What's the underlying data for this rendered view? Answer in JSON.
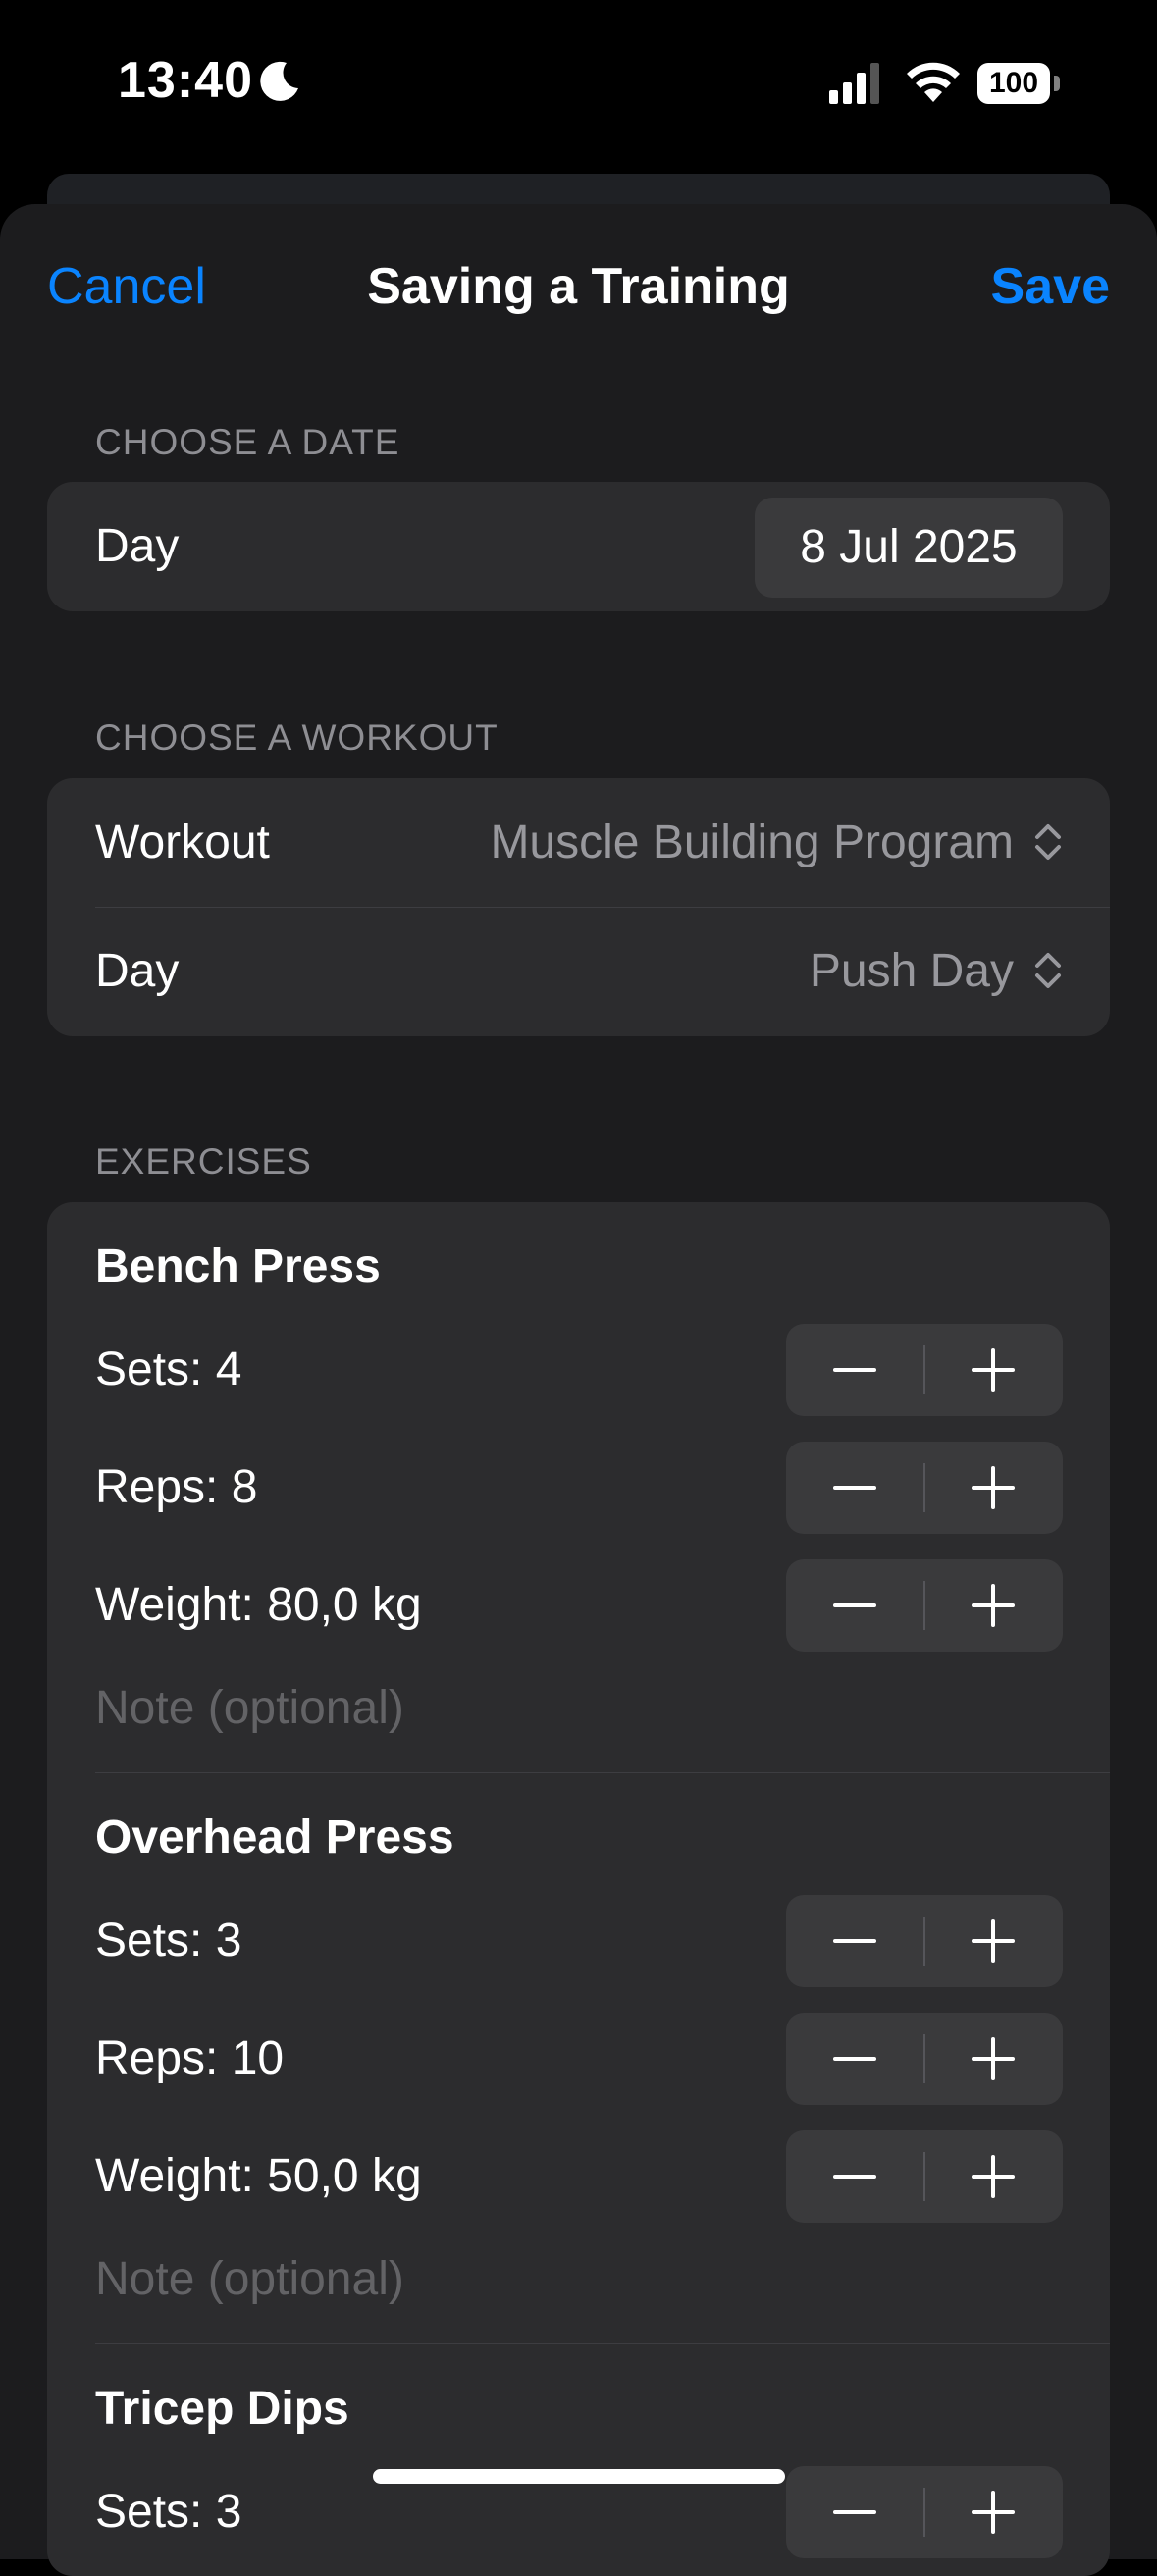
{
  "status": {
    "time": "13:40",
    "battery": "100"
  },
  "nav": {
    "cancel": "Cancel",
    "title": "Saving a Training",
    "save": "Save"
  },
  "date_section": {
    "header": "CHOOSE A DATE",
    "label": "Day",
    "value": "8 Jul 2025"
  },
  "workout_section": {
    "header": "CHOOSE A WORKOUT",
    "workout_label": "Workout",
    "workout_value": "Muscle Building Program",
    "day_label": "Day",
    "day_value": "Push Day"
  },
  "exercises": {
    "header": "EXERCISES",
    "items": [
      {
        "name": "Bench Press",
        "sets": "Sets: 4",
        "reps": "Reps: 8",
        "weight": "Weight: 80,0 kg",
        "note_placeholder": "Note (optional)"
      },
      {
        "name": "Overhead Press",
        "sets": "Sets: 3",
        "reps": "Reps: 10",
        "weight": "Weight: 50,0 kg",
        "note_placeholder": "Note (optional)"
      },
      {
        "name": "Tricep Dips",
        "sets": "Sets: 3"
      }
    ]
  },
  "colors": {
    "accent": "#0a84ff",
    "sheet": "#1c1c1e",
    "card": "#2c2c2e",
    "control": "#3a3a3c"
  },
  "icons": [
    "moon-icon",
    "signal-icon",
    "wifi-icon",
    "battery-icon",
    "chevron-updown-icon",
    "minus-icon",
    "plus-icon"
  ]
}
